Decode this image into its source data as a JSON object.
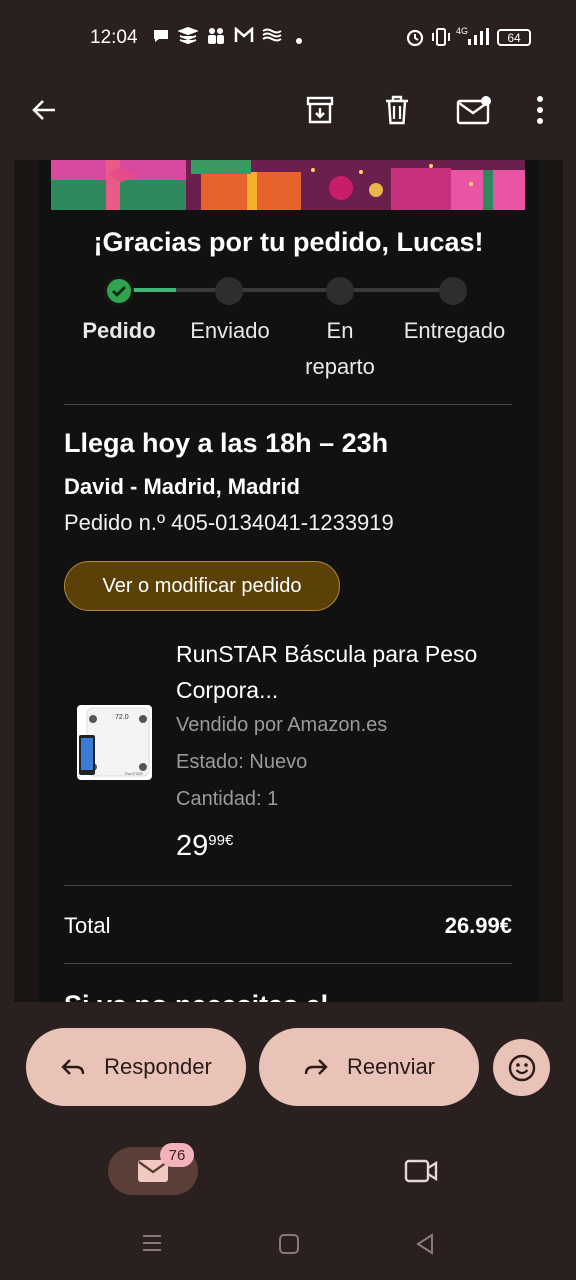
{
  "status_bar": {
    "time": "12:04",
    "network": "4G",
    "battery": "64",
    "icons": [
      "chat-icon",
      "layers-icon",
      "people-icon",
      "gmail-icon",
      "wave-icon",
      "dot-icon",
      "alarm-icon",
      "vibrate-icon",
      "signal-icon",
      "battery-icon"
    ]
  },
  "toolbar": {
    "icons": [
      "back-arrow-icon",
      "archive-icon",
      "delete-icon",
      "mark-unread-icon",
      "more-vert-icon"
    ]
  },
  "email": {
    "greeting": "¡Gracias por tu pedido, Lucas!",
    "progress": {
      "steps": [
        "Pedido",
        "Enviado",
        "En reparto",
        "Entregado"
      ],
      "step_lines": [
        [
          "Pedido"
        ],
        [
          "Enviado"
        ],
        [
          "En",
          "reparto"
        ],
        [
          "Entregado"
        ]
      ],
      "current_step": 0
    },
    "delivery_heading": "Llega hoy a las 18h – 23h",
    "address": "David - Madrid, Madrid",
    "order_number": "Pedido n.º 405-0134041-1233919",
    "modify_button": "Ver o modificar pedido",
    "product": {
      "name_line1": "RunSTAR Báscula para Peso",
      "name_line2": "Corpora...",
      "seller": "Vendido por Amazon.es",
      "condition": "Estado: Nuevo",
      "quantity": "Cantidad: 1",
      "price_whole": "29",
      "price_fraction": "99€",
      "scale_display": "72.0",
      "brand": "RunSTAR"
    },
    "total_label": "Total",
    "total_value": "26.99€",
    "cutoff_heading": "Si ya no necesitas el"
  },
  "actions": {
    "reply": "Responder",
    "forward": "Reenviar"
  },
  "bottom_nav": {
    "mail_badge": "76"
  },
  "colors": {
    "background": "#2a201f",
    "panel": "#111111",
    "accent_green": "#2ea44f",
    "pill": "#e9c2b8",
    "modify_button": "#5b4008",
    "badge": "#f3b3ba"
  }
}
